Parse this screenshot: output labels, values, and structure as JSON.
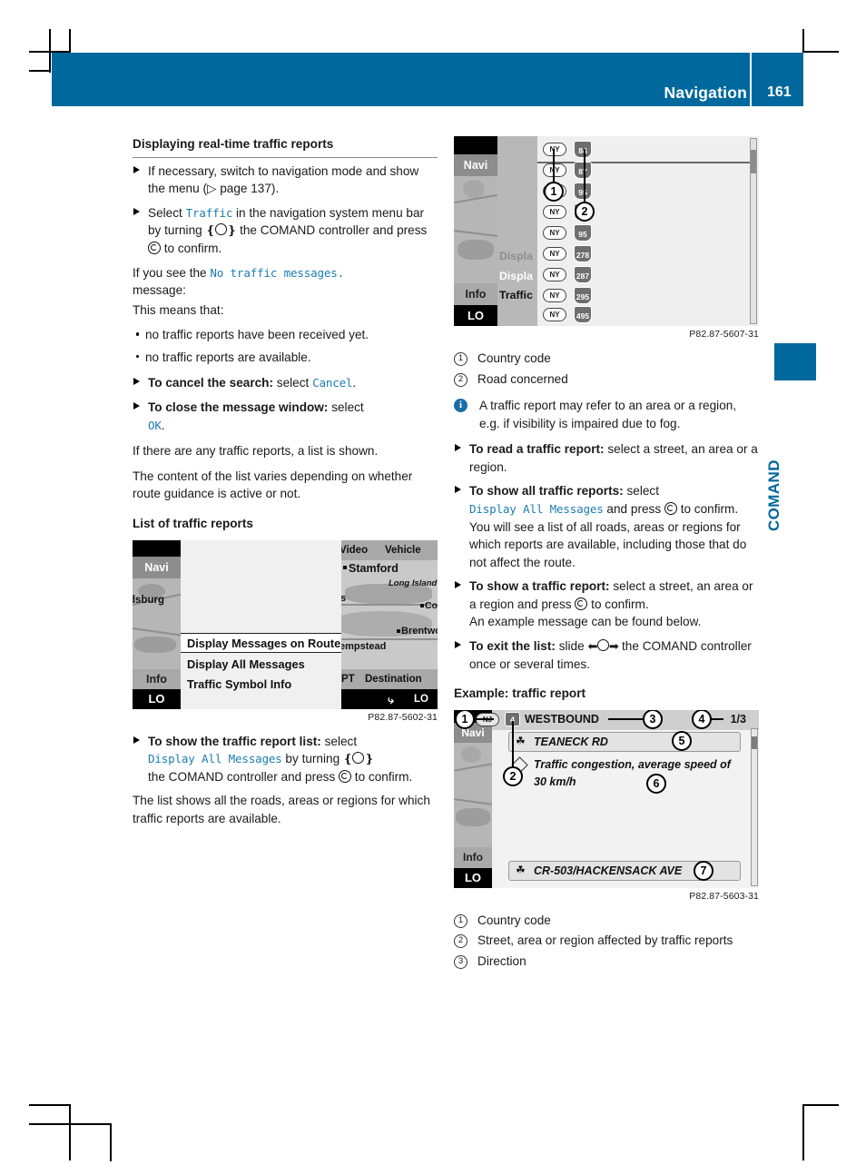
{
  "header": {
    "title": "Navigation",
    "page_number": "161",
    "accent_color": "#00689c"
  },
  "side_tab": {
    "label": "COMAND"
  },
  "left_column": {
    "section_title": "Displaying real-time traffic reports",
    "step1": {
      "text_a": "If necessary, switch to navigation mode and show the menu (",
      "ref": "page 137",
      "text_b": ")."
    },
    "step2": {
      "a": "Select ",
      "code": "Traffic",
      "b": " in the navigation system menu bar by turning ",
      "c": " the COMAND controller and press ",
      "d": " to confirm."
    },
    "para_if_you_see_a": "If you see the ",
    "para_if_you_see_code": "No traffic messages.",
    "para_if_you_see_b": "message:",
    "para_this_means": "This means that:",
    "bullets": [
      "no traffic reports have been received yet.",
      "no traffic reports are available."
    ],
    "step_cancel": {
      "bold": "To cancel the search:",
      "a": " select ",
      "code": "Cancel",
      "b": "."
    },
    "step_close": {
      "bold": "To close the message window:",
      "a": " select ",
      "code": "OK",
      "b": "."
    },
    "para_if_any": "If there are any traffic reports, a list is shown.",
    "para_content_varies": "The content of the list varies depending on whether route guidance is active or not.",
    "subsection_title": "List of traffic reports",
    "figure_caption": "P82.87-5602-31",
    "step_show_list": {
      "bold": "To show the traffic report list:",
      "a": " select ",
      "code": "Display All Messages",
      "b": " by turning ",
      "c": " the COMAND controller and press ",
      "d": " to confirm."
    },
    "para_list_shows": "The list shows all the roads, areas or regions for which traffic reports are available."
  },
  "right_column": {
    "figure_caption_top": "P82.87-5607-31",
    "legend_top": [
      {
        "num": "1",
        "text": "Country code"
      },
      {
        "num": "2",
        "text": "Road concerned"
      }
    ],
    "note": "A traffic report may refer to an area or a region, e.g. if visibility is impaired due to fog.",
    "step_read": {
      "bold": "To read a traffic report:",
      "a": " select a street, an area or a region."
    },
    "step_show_all": {
      "bold": "To show all traffic reports:",
      "a": " select ",
      "code": "Display All Messages",
      "b": " and press ",
      "c": " to confirm.",
      "extra": "You will see a list of all roads, areas or regions for which reports are available, including those that do not affect the route."
    },
    "step_show_one": {
      "bold": "To show a traffic report:",
      "a": " select a street, an area or a region and press ",
      "b": " to confirm.",
      "extra": "An example message can be found below."
    },
    "step_exit": {
      "bold": "To exit the list:",
      "a": " slide ",
      "b": " the COMAND controller once or several times."
    },
    "subsection_title": "Example: traffic report",
    "figure_caption_bottom": "P82.87-5603-31",
    "legend_bottom": [
      {
        "num": "1",
        "text": "Country code"
      },
      {
        "num": "2",
        "text": "Street, area or region affected by traffic reports"
      },
      {
        "num": "3",
        "text": "Direction"
      }
    ]
  },
  "screenshot_list_of_reports": {
    "sidebar": {
      "navi": "Navi",
      "info": "Info",
      "lo": "LO"
    },
    "menu_items": [
      "Display Messages on Route",
      "Display All Messages",
      "Traffic Symbol Info"
    ],
    "selected_index": 0,
    "map_top_labels": [
      "Video",
      "Vehicle"
    ],
    "map_bottom_labels": [
      "PT",
      "Destination"
    ],
    "map_places": [
      "Stamford",
      "Long Island",
      "Cor",
      "Brentwood",
      "empstead",
      "dsburg",
      "s"
    ],
    "status_lo": "LO"
  },
  "screenshot_country_road_list": {
    "sidebar": {
      "navi": "Navi",
      "info": "Info",
      "lo": "LO"
    },
    "mid_menu": [
      "Displa",
      "Displa",
      "Traffic"
    ],
    "rows": [
      {
        "country": "NY",
        "road": "84"
      },
      {
        "country": "NY",
        "road": "87"
      },
      {
        "country": "NY",
        "road": "95"
      },
      {
        "country": "NY",
        "road": "95"
      },
      {
        "country": "NY",
        "road": "95"
      },
      {
        "country": "NY",
        "road": "278"
      },
      {
        "country": "NY",
        "road": "287"
      },
      {
        "country": "NY",
        "road": "295"
      },
      {
        "country": "NY",
        "road": "495"
      }
    ],
    "callouts": [
      "1",
      "2"
    ]
  },
  "screenshot_example_report": {
    "sidebar": {
      "navi": "Navi",
      "info": "Info",
      "lo": "LO"
    },
    "country_code": "NJ",
    "road_badge": "4",
    "direction": "WESTBOUND",
    "page_indicator": "1/3",
    "street_top": "TEANECK RD",
    "message": "Traffic congestion, average speed of 30 km/h",
    "message_line1": "Traffic congestion, average speed of",
    "message_line2": "30 km/h",
    "street_bottom": "CR-503/HACKENSACK AVE",
    "callouts": [
      "1",
      "2",
      "3",
      "4",
      "5",
      "6",
      "7"
    ]
  }
}
